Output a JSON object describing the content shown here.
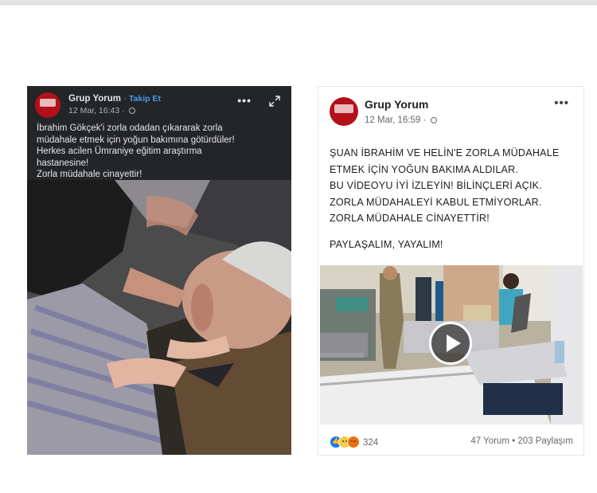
{
  "left_post": {
    "page_name": "Grup Yorum",
    "follow_label": "Takip Et",
    "timestamp": "12 Mar, 16:43",
    "menu_label": "•••",
    "text_lines": [
      "İbrahim Gökçek'i zorla odadan çıkararak zorla",
      "müdahale etmek için yoğun bakımına götürdüler!",
      "Herkes acilen Ümraniye eğitim araştırma",
      "hastanesine!",
      "Zorla müdahale cinayettir!"
    ]
  },
  "right_post": {
    "page_name": "Grup Yorum",
    "timestamp": "12 Mar, 16:59",
    "menu_label": "•••",
    "text_lines": [
      "ŞUAN İBRAHİM VE HELİN'E ZORLA MÜDAHALE",
      "ETMEK İÇİN YOĞUN BAKIMA ALDILAR.",
      "BU VİDEOYU İYİ İZLEYİN! BİLİNÇLERİ AÇIK.",
      "ZORLA MÜDAHALEYİ KABUL ETMİYORLAR.",
      "ZORLA MÜDAHALE CİNAYETTİR!"
    ],
    "closing_line": "PAYLAŞALIM, YAYALIM!",
    "reaction_count": "324",
    "comments_shares": "47 Yorum • 203 Paylaşım"
  },
  "colors": {
    "dark_card": "#242526",
    "follow_link": "#4a9af0",
    "avatar_red": "#b3111a"
  },
  "icons": [
    "globe-icon",
    "expand-icon",
    "play-icon",
    "like-reaction-icon",
    "sad-reaction-icon",
    "angry-reaction-icon"
  ]
}
